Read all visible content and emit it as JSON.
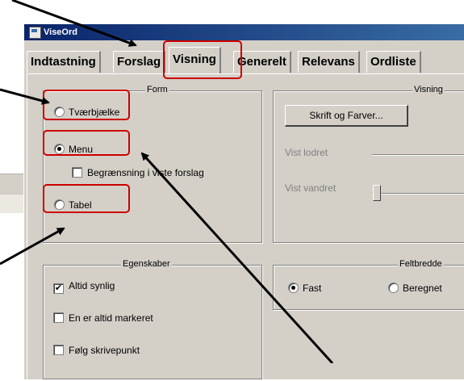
{
  "window": {
    "title": "ViseOrd"
  },
  "tabs": [
    {
      "label": "Indtastning"
    },
    {
      "label": "Forslag"
    },
    {
      "label": "Visning"
    },
    {
      "label": "Generelt"
    },
    {
      "label": "Relevans"
    },
    {
      "label": "Ordliste"
    }
  ],
  "active_tab": "Visning",
  "form_group": {
    "label": "Form",
    "options": [
      {
        "label": "Tværbjælke",
        "selected": false
      },
      {
        "label": "Menu",
        "selected": true
      },
      {
        "label": "Tabel",
        "selected": false
      }
    ],
    "limit_checkbox": {
      "label": "Begrænsning i viste forslag",
      "checked": false
    }
  },
  "visning_group": {
    "label": "Visning",
    "button_label": "Skrift og Farver...",
    "vertical_label": "Vist lodret",
    "horizontal_label": "Vist vandret"
  },
  "egenskaber_group": {
    "label": "Egenskaber",
    "options": [
      {
        "label": "Altid synlig",
        "checked": true
      },
      {
        "label": "En er altid markeret",
        "checked": false
      },
      {
        "label": "Følg skrivepunkt",
        "checked": false
      }
    ]
  },
  "feltbredde_group": {
    "label": "Feltbredde",
    "options": [
      {
        "label": "Fast",
        "selected": true
      },
      {
        "label": "Beregnet",
        "selected": false
      }
    ]
  },
  "colors": {
    "highlight": "#cc0000",
    "title_bar": "#0a246a"
  }
}
